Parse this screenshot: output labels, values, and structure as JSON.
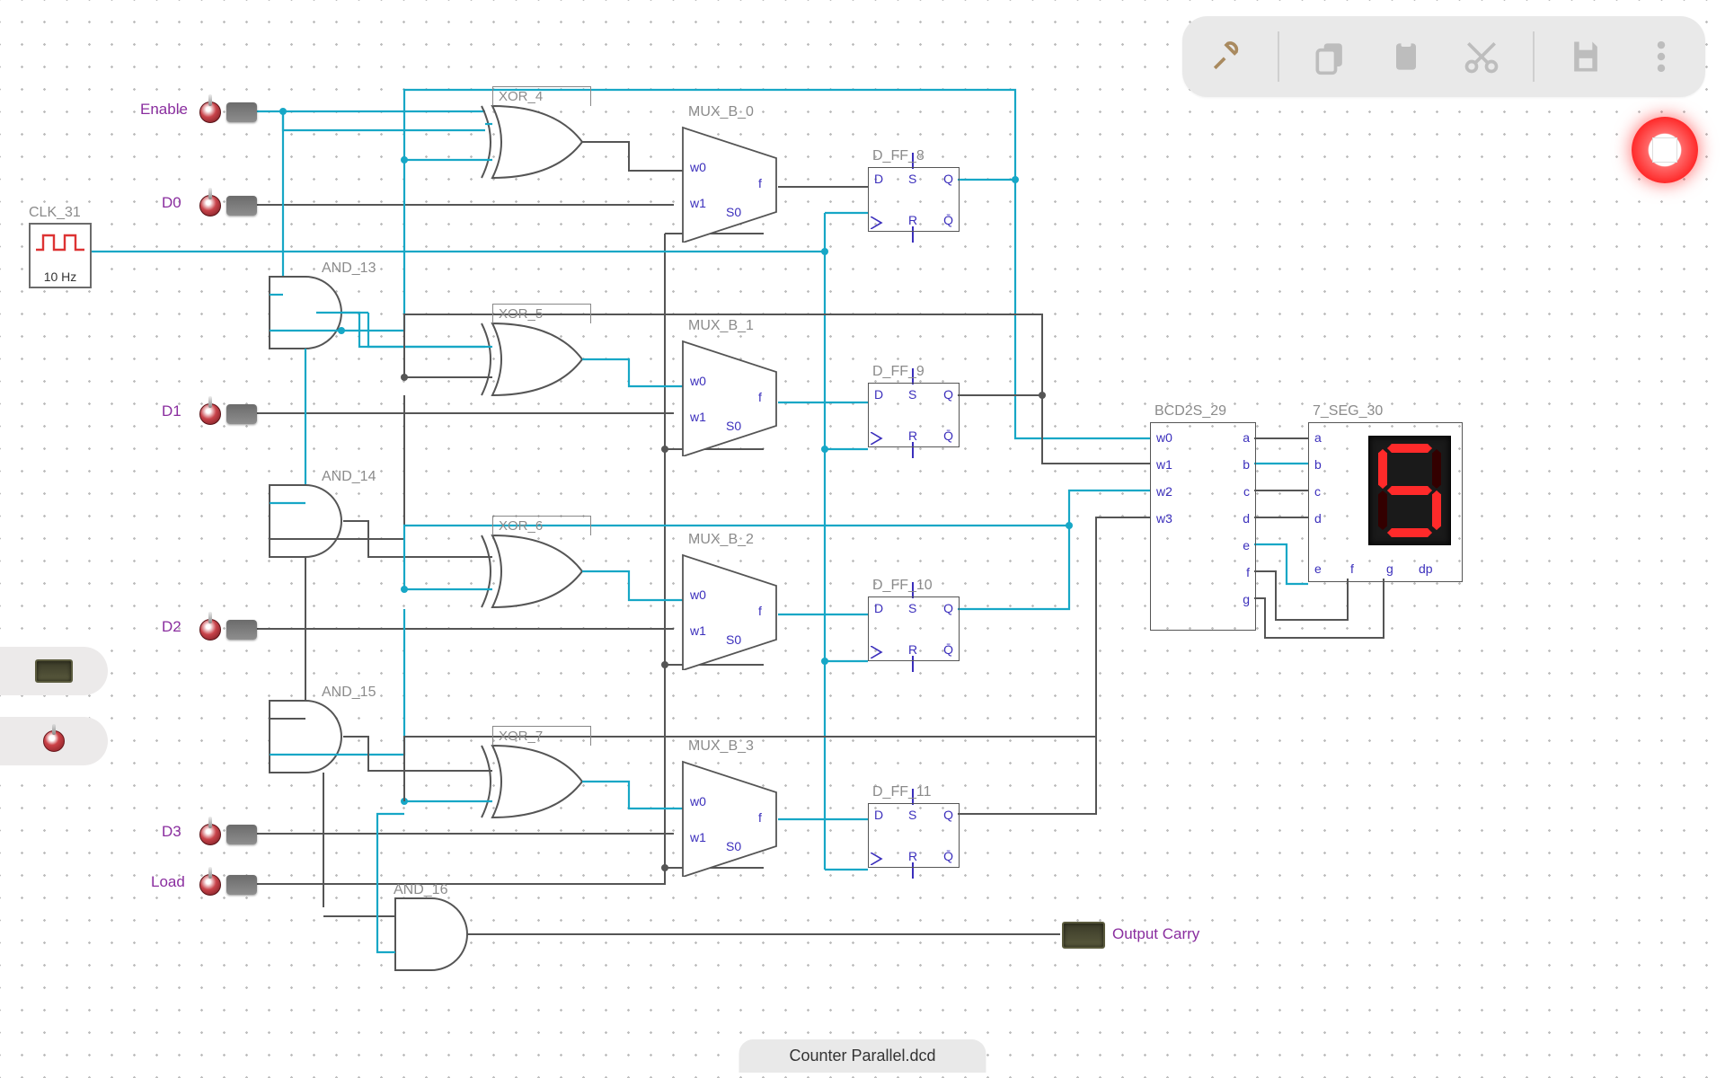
{
  "filename": "Counter Parallel.dcd",
  "clock": {
    "label": "CLK_31",
    "freq": "10 Hz"
  },
  "inputs": {
    "enable": "Enable",
    "d0": "D0",
    "d1": "D1",
    "d2": "D2",
    "d3": "D3",
    "load": "Load"
  },
  "gates": {
    "and13": "AND_13",
    "and14": "AND_14",
    "and15": "AND_15",
    "and16": "AND_16",
    "xor4": "XOR_4",
    "xor5": "XOR_5",
    "xor6": "XOR_6",
    "xor7": "XOR_7"
  },
  "mux": {
    "m0": "MUX_B_0",
    "m1": "MUX_B_1",
    "m2": "MUX_B_2",
    "m3": "MUX_B_3",
    "pins": {
      "w0": "w0",
      "w1": "w1",
      "s0": "S0",
      "f": "f"
    }
  },
  "ff": {
    "ff8": "D_FF_8",
    "ff9": "D_FF_9",
    "ff10": "D_FF_10",
    "ff11": "D_FF_11",
    "pins": {
      "D": "D",
      "S": "S",
      "Q": "Q",
      "R": "R",
      "Qb": "Q̄"
    }
  },
  "bcd": {
    "label": "BCD2S_29",
    "in": [
      "w0",
      "w1",
      "w2",
      "w3"
    ],
    "out": [
      "a",
      "b",
      "c",
      "d",
      "e",
      "f",
      "g"
    ]
  },
  "seg": {
    "label": "7_SEG_30",
    "pins": [
      "a",
      "b",
      "c",
      "d",
      "e",
      "f",
      "g",
      "dp"
    ],
    "digit": "5",
    "segments": {
      "a": true,
      "b": false,
      "c": true,
      "d": true,
      "e": false,
      "f": true,
      "g": true
    }
  },
  "output": {
    "carry": "Output Carry"
  },
  "toolbar": {
    "tools": "tools",
    "copy": "copy",
    "paste": "paste",
    "cut": "cut",
    "save": "save",
    "more": "more",
    "stop": "stop"
  }
}
